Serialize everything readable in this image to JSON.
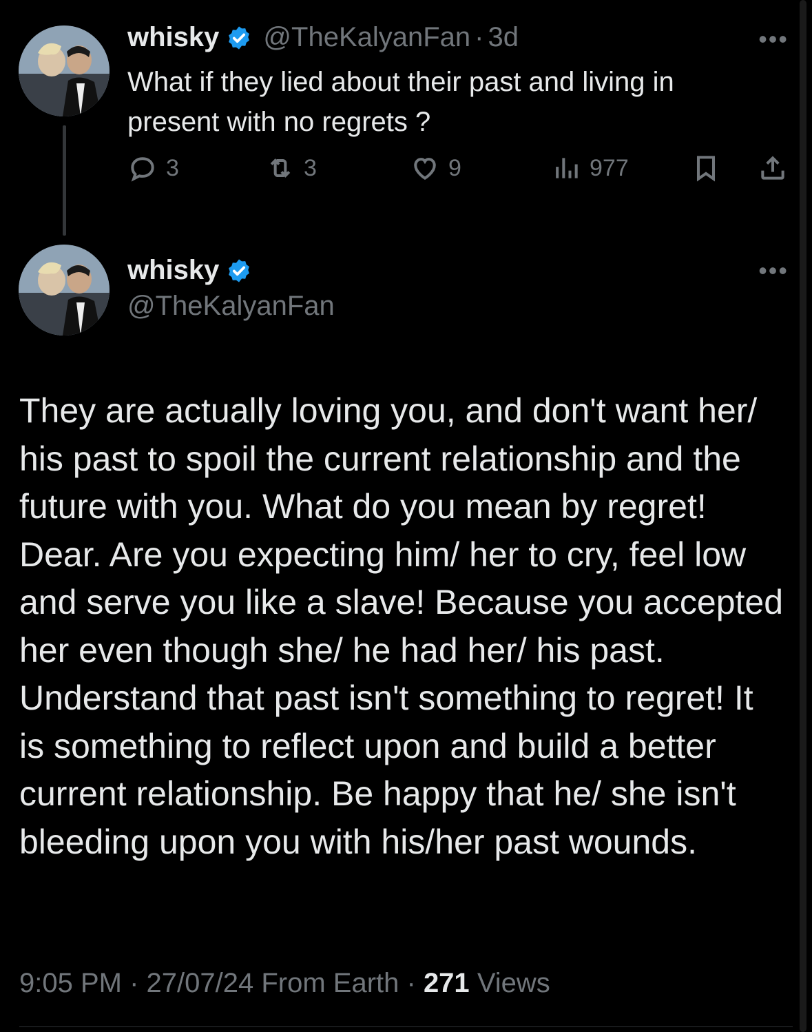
{
  "parent_tweet": {
    "display_name": "whisky",
    "handle": "@TheKalyanFan",
    "separator": "·",
    "time": "3d",
    "text": "What if they lied about their past and living in present with no regrets ?",
    "more_label": "•••",
    "actions": {
      "replies": "3",
      "retweets": "3",
      "likes": "9",
      "views": "977"
    }
  },
  "main_tweet": {
    "display_name": "whisky",
    "handle": "@TheKalyanFan",
    "more_label": "•••",
    "text": "They are actually loving you, and don't want her/ his past to spoil the current relationship and the future with you. What do you mean by regret! Dear. Are you expecting him/ her to cry, feel low and serve you like a slave! Because you accepted her even though she/ he had her/ his past.\nUnderstand that past isn't something to regret! It is something to reflect upon and build a better current relationship. Be happy that he/ she isn't bleeding upon you with his/her past wounds.",
    "meta": {
      "time_date": "9:05 PM · 27/07/24 From Earth ·",
      "views_count": "271",
      "views_label": "Views"
    }
  },
  "colors": {
    "background": "#000000",
    "text": "#e7e9ea",
    "muted": "#71767b",
    "verified": "#1d9bf0"
  },
  "icons": [
    "verified-badge-icon",
    "reply-icon",
    "retweet-icon",
    "like-icon",
    "views-icon",
    "bookmark-icon",
    "share-icon",
    "more-icon"
  ]
}
